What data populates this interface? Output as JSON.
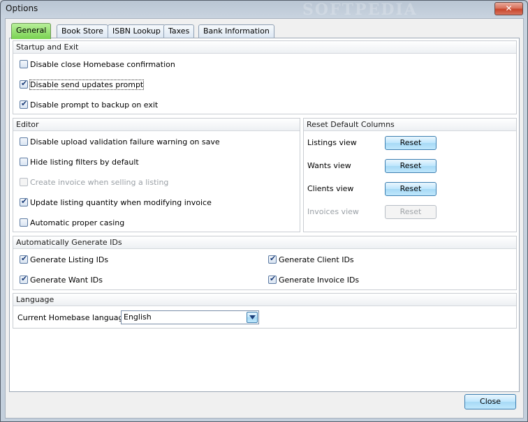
{
  "window": {
    "title": "Options",
    "watermark": "SOFTPEDIA",
    "close_glyph": "✕"
  },
  "tabs": [
    {
      "label": "General",
      "active": true
    },
    {
      "label": "Book Store",
      "active": false
    },
    {
      "label": "ISBN Lookup",
      "active": false
    },
    {
      "label": "Taxes",
      "active": false
    },
    {
      "label": "Bank Information",
      "active": false
    }
  ],
  "startup": {
    "title": "Startup and Exit",
    "items": [
      {
        "label": "Disable close Homebase confirmation",
        "checked": false
      },
      {
        "label": "Disable send updates prompt",
        "checked": true
      },
      {
        "label": "Disable prompt to backup on exit",
        "checked": true
      }
    ]
  },
  "editor": {
    "title": "Editor",
    "items": [
      {
        "label": "Disable upload validation failure warning on save",
        "checked": false,
        "enabled": true
      },
      {
        "label": "Hide listing filters by default",
        "checked": false,
        "enabled": true
      },
      {
        "label": "Create invoice when selling a listing",
        "checked": false,
        "enabled": false
      },
      {
        "label": "Update listing quantity when modifying invoice",
        "checked": true,
        "enabled": true
      },
      {
        "label": "Automatic proper casing",
        "checked": false,
        "enabled": true
      }
    ]
  },
  "reset_columns": {
    "title": "Reset Default Columns",
    "button_label": "Reset",
    "rows": [
      {
        "label": "Listings view",
        "enabled": true
      },
      {
        "label": "Wants view",
        "enabled": true
      },
      {
        "label": "Clients view",
        "enabled": true
      },
      {
        "label": "Invoices view",
        "enabled": false
      }
    ]
  },
  "ids": {
    "title": "Automatically Generate IDs",
    "items": [
      {
        "label": "Generate Listing IDs",
        "checked": true
      },
      {
        "label": "Generate Client IDs",
        "checked": true
      },
      {
        "label": "Generate Want IDs",
        "checked": true
      },
      {
        "label": "Generate Invoice IDs",
        "checked": true
      }
    ]
  },
  "language": {
    "title": "Language",
    "label": "Current Homebase language:",
    "selected": "English"
  },
  "footer": {
    "close_label": "Close"
  }
}
